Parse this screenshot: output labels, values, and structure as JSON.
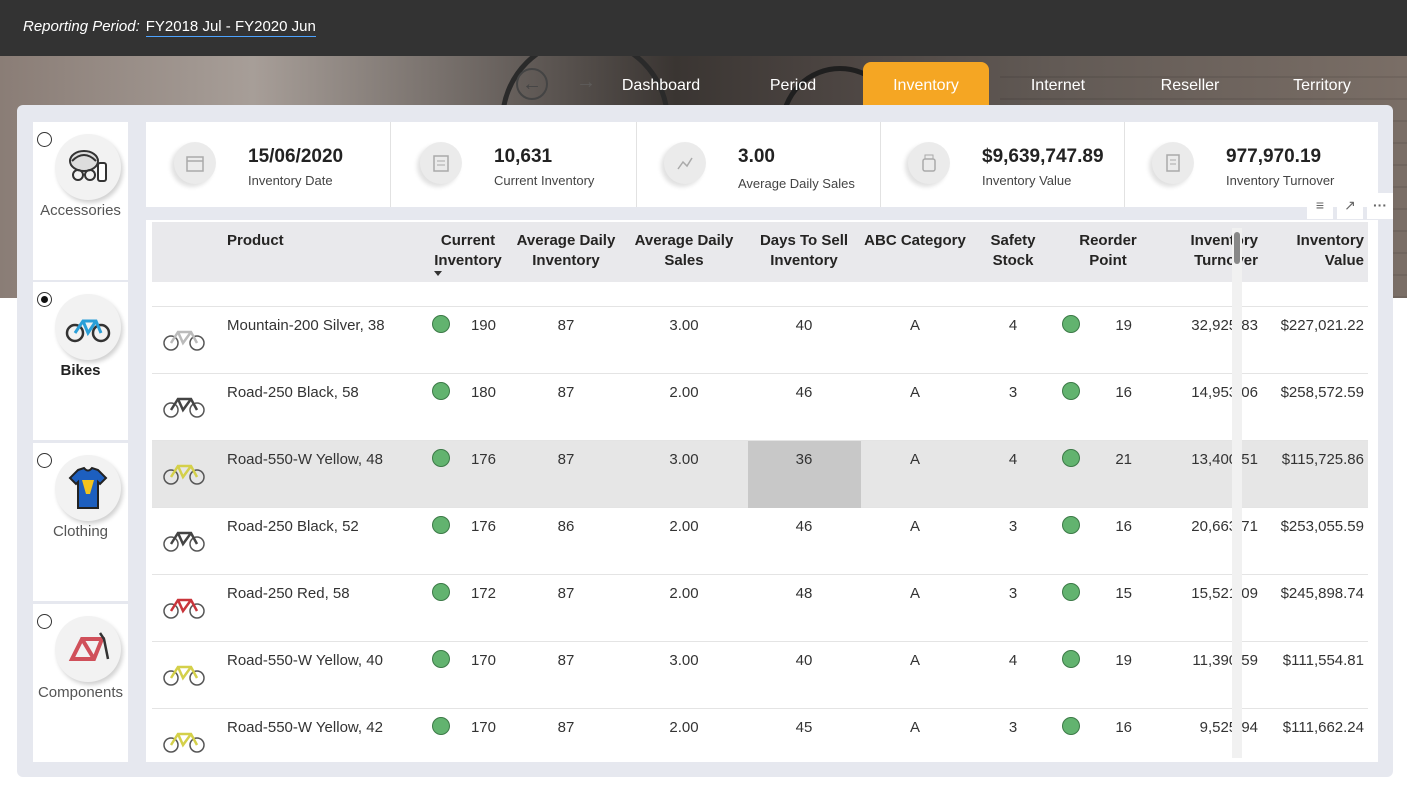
{
  "header": {
    "period_label": "Reporting Period:",
    "period_value": "FY2018  Jul - FY2020  Jun"
  },
  "nav": {
    "back": "back-arrow",
    "forward": "forward-arrow",
    "tabs": [
      {
        "label": "Dashboard",
        "active": false
      },
      {
        "label": "Period",
        "active": false
      },
      {
        "label": "Inventory",
        "active": true
      },
      {
        "label": "Internet",
        "active": false
      },
      {
        "label": "Reseller",
        "active": false
      },
      {
        "label": "Territory",
        "active": false
      }
    ]
  },
  "categories": [
    {
      "label": "Accessories",
      "selected": false
    },
    {
      "label": "Bikes",
      "selected": true
    },
    {
      "label": "Clothing",
      "selected": false
    },
    {
      "label": "Components",
      "selected": false
    }
  ],
  "kpis": [
    {
      "value": "15/06/2020",
      "label": "Inventory Date",
      "icon": "calendar-icon"
    },
    {
      "value": "10,631",
      "label": "Current Inventory",
      "icon": "inventory-icon"
    },
    {
      "value": "3.00",
      "label": "Average Daily Sales",
      "icon": "sales-chart-icon"
    },
    {
      "value": "$9,639,747.89",
      "label": "Inventory Value",
      "icon": "money-jar-icon"
    },
    {
      "value": "977,970.19",
      "label": "Inventory Turnover",
      "icon": "turnover-report-icon"
    }
  ],
  "visual_header": {
    "filter": "filter-icon",
    "focus": "focus-mode-icon",
    "more": "···"
  },
  "table": {
    "columns": [
      {
        "l1": "Product",
        "l2": ""
      },
      {
        "l1": "Current",
        "l2": "Inventory"
      },
      {
        "l1": "Average Daily",
        "l2": "Inventory"
      },
      {
        "l1": "Average Daily",
        "l2": "Sales"
      },
      {
        "l1": "Days To Sell",
        "l2": "Inventory"
      },
      {
        "l1": "ABC Category",
        "l2": ""
      },
      {
        "l1": "Safety",
        "l2": "Stock"
      },
      {
        "l1": "Reorder",
        "l2": "Point"
      },
      {
        "l1": "Inventory",
        "l2": "Turnover"
      },
      {
        "l1": "Inventory",
        "l2": "Value"
      }
    ],
    "rows": [
      {
        "product": "Mountain-200 Silver, 38",
        "current": "190",
        "avg_inv": "87",
        "avg_sales": "3.00",
        "days": "40",
        "abc": "A",
        "safety": "4",
        "reorder": "19",
        "turnover": "32,925.83",
        "value": "$227,021.22",
        "bike_color": "#bbbbbb",
        "highlight": false
      },
      {
        "product": "Road-250 Black, 58",
        "current": "180",
        "avg_inv": "87",
        "avg_sales": "2.00",
        "days": "46",
        "abc": "A",
        "safety": "3",
        "reorder": "16",
        "turnover": "14,953.06",
        "value": "$258,572.59",
        "bike_color": "#444444",
        "highlight": false
      },
      {
        "product": "Road-550-W Yellow, 48",
        "current": "176",
        "avg_inv": "87",
        "avg_sales": "3.00",
        "days": "36",
        "abc": "A",
        "safety": "4",
        "reorder": "21",
        "turnover": "13,400.51",
        "value": "$115,725.86",
        "bike_color": "#d4d04a",
        "highlight": true
      },
      {
        "product": "Road-250 Black, 52",
        "current": "176",
        "avg_inv": "86",
        "avg_sales": "2.00",
        "days": "46",
        "abc": "A",
        "safety": "3",
        "reorder": "16",
        "turnover": "20,663.71",
        "value": "$253,055.59",
        "bike_color": "#444444",
        "highlight": false
      },
      {
        "product": "Road-250 Red, 58",
        "current": "172",
        "avg_inv": "87",
        "avg_sales": "2.00",
        "days": "48",
        "abc": "A",
        "safety": "3",
        "reorder": "15",
        "turnover": "15,521.09",
        "value": "$245,898.74",
        "bike_color": "#c9353b",
        "highlight": false
      },
      {
        "product": "Road-550-W Yellow, 40",
        "current": "170",
        "avg_inv": "87",
        "avg_sales": "3.00",
        "days": "40",
        "abc": "A",
        "safety": "4",
        "reorder": "19",
        "turnover": "11,390.59",
        "value": "$111,554.81",
        "bike_color": "#d4d04a",
        "highlight": false
      },
      {
        "product": "Road-550-W Yellow, 42",
        "current": "170",
        "avg_inv": "87",
        "avg_sales": "2.00",
        "days": "45",
        "abc": "A",
        "safety": "3",
        "reorder": "16",
        "turnover": "9,525.94",
        "value": "$111,662.24",
        "bike_color": "#d4d04a",
        "highlight": false
      }
    ]
  },
  "colors": {
    "accent": "#f5a623",
    "status_green": "#62b36f",
    "topbar": "#333333"
  }
}
